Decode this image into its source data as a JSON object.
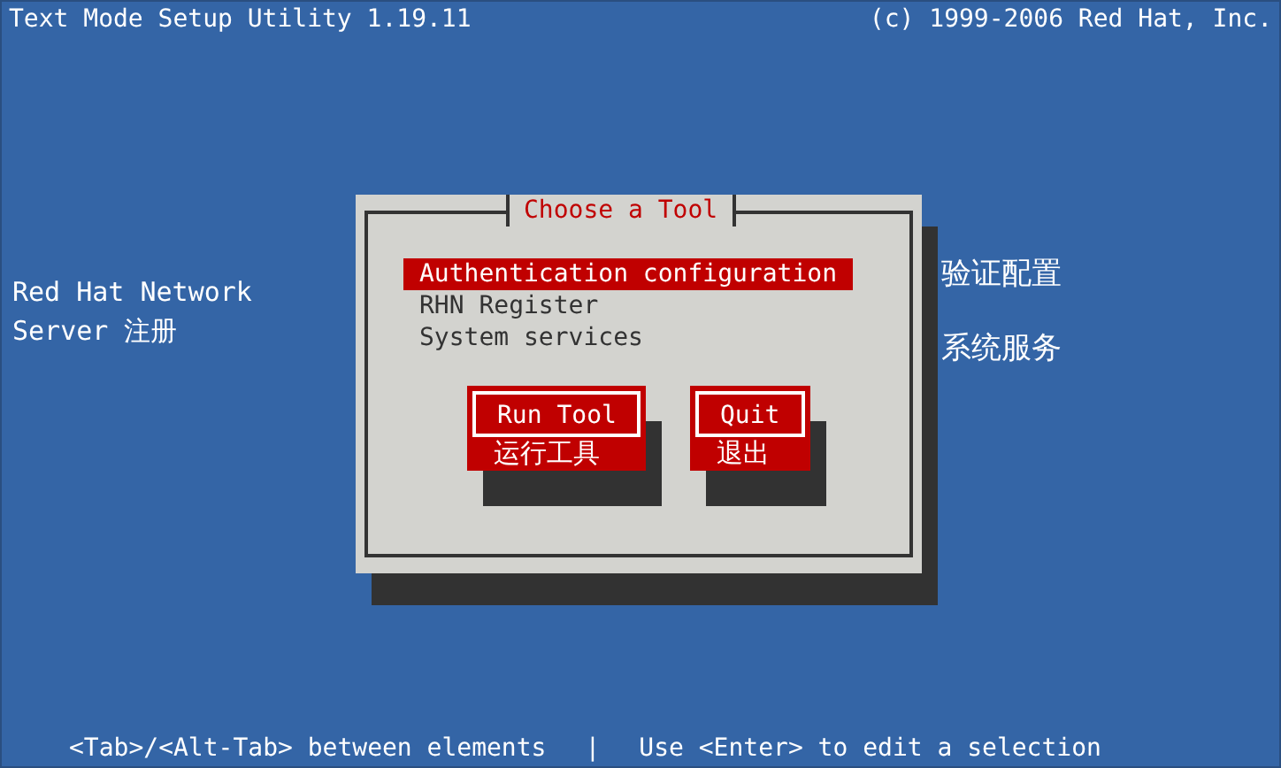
{
  "header": {
    "title": "Text Mode Setup Utility 1.19.11",
    "copyright": "(c) 1999-2006 Red Hat, Inc."
  },
  "dialog": {
    "title": "Choose a Tool",
    "items": [
      {
        "label": "Authentication configuration",
        "selected": true
      },
      {
        "label": "RHN Register",
        "selected": false
      },
      {
        "label": "System services",
        "selected": false
      }
    ],
    "buttons": [
      {
        "label": "Run Tool",
        "note": "运行工具"
      },
      {
        "label": "Quit",
        "note": "退出"
      }
    ]
  },
  "annotations": [
    {
      "text": "验证配置",
      "kind": "item-note"
    },
    {
      "text": "系统服务",
      "kind": "item-note"
    }
  ],
  "side_note": {
    "line_1": "Red Hat Network",
    "line_2": "Server 注册"
  },
  "status_bar": {
    "left": "<Tab>/<Alt-Tab> between elements",
    "separator": "|",
    "right": "Use <Enter> to edit a selection"
  }
}
